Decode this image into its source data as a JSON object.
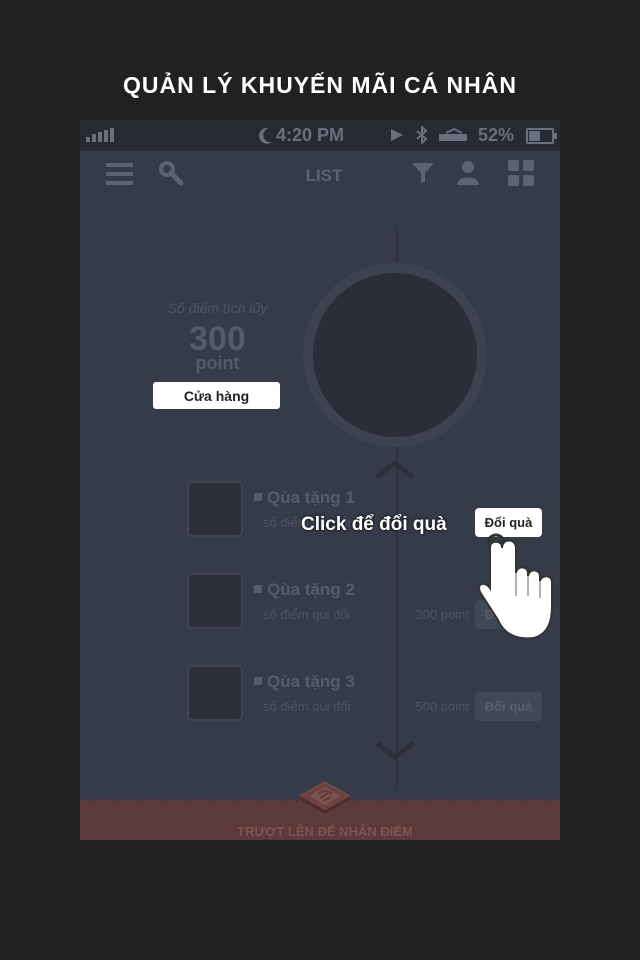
{
  "header": {
    "title": "QUẢN LÝ KHUYẾN MÃI CÁ NHÂN"
  },
  "status_bar": {
    "time": "4:20 PM",
    "battery": "52%"
  },
  "navbar": {
    "title": "LIST"
  },
  "points": {
    "label": "Số điểm tích lũy",
    "value": "300",
    "unit": "point",
    "shop_label": "Cửa hàng"
  },
  "gifts": [
    {
      "name": "Qùa tặng 1",
      "sub": "số điểm qui đổi",
      "points": "",
      "button": "Đổi quà"
    },
    {
      "name": "Qùa tặng 2",
      "sub": "số điểm qui đổi",
      "points": "300 point",
      "button": "Đổi quà"
    },
    {
      "name": "Qùa tặng 3",
      "sub": "số điểm qui đổi",
      "points": "500 point",
      "button": "Đổi quà"
    }
  ],
  "tooltip": {
    "text": "Click để đổi quà"
  },
  "footer": {
    "text": "TRƯỢT LÊN ĐỂ NHẬN ĐIỂM"
  },
  "colors": {
    "background": "#212121",
    "screen": "#353b48",
    "footer": "#5c3a3a"
  },
  "icons": [
    "menu-icon",
    "search-icon",
    "filter-icon",
    "user-icon",
    "grid-icon",
    "moon-icon",
    "play-icon",
    "bluetooth-icon",
    "hand-pointer-icon",
    "qr-code-icon"
  ]
}
